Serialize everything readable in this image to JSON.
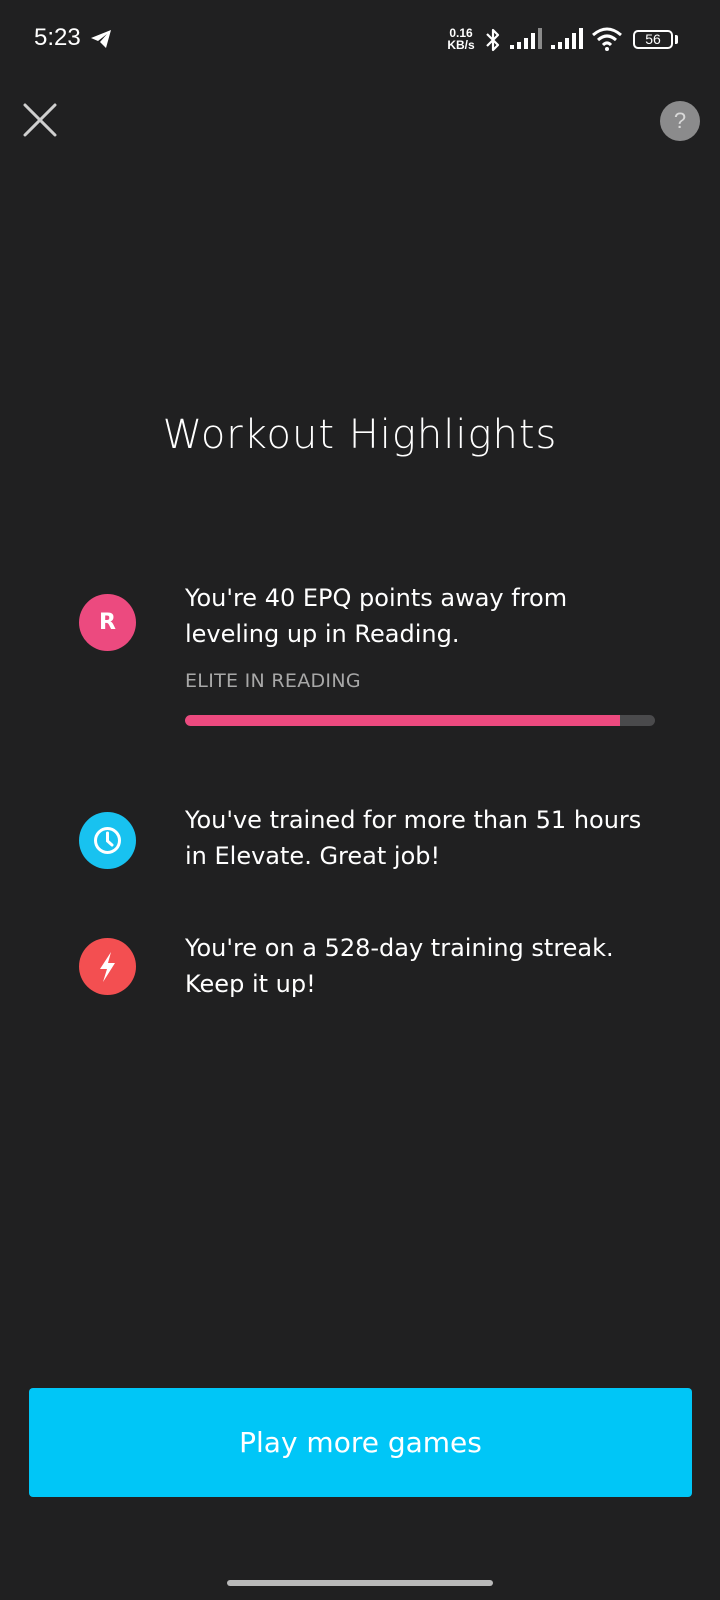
{
  "status_bar": {
    "time": "5:23",
    "net_speed_value": "0.16",
    "net_speed_unit": "KB/s",
    "battery_level": "56"
  },
  "header": {
    "close_icon": "close-icon",
    "help_label": "?"
  },
  "title": "Workout Highlights",
  "highlights": [
    {
      "icon": "reading-icon",
      "icon_letter": "R",
      "icon_color": "#ec4a7f",
      "text": "You're 40 EPQ points away from leveling up in Reading.",
      "sublabel": "ELITE IN READING",
      "progress": 0.925
    },
    {
      "icon": "clock-icon",
      "icon_color": "#18c2f0",
      "text": "You've trained for more than 51 hours in Elevate. Great job!"
    },
    {
      "icon": "lightning-icon",
      "icon_color": "#f34f51",
      "text": "You're on a 528-day training streak. Keep it up!"
    }
  ],
  "primary_button": {
    "label": "Play more games",
    "color": "#00c6f7"
  }
}
